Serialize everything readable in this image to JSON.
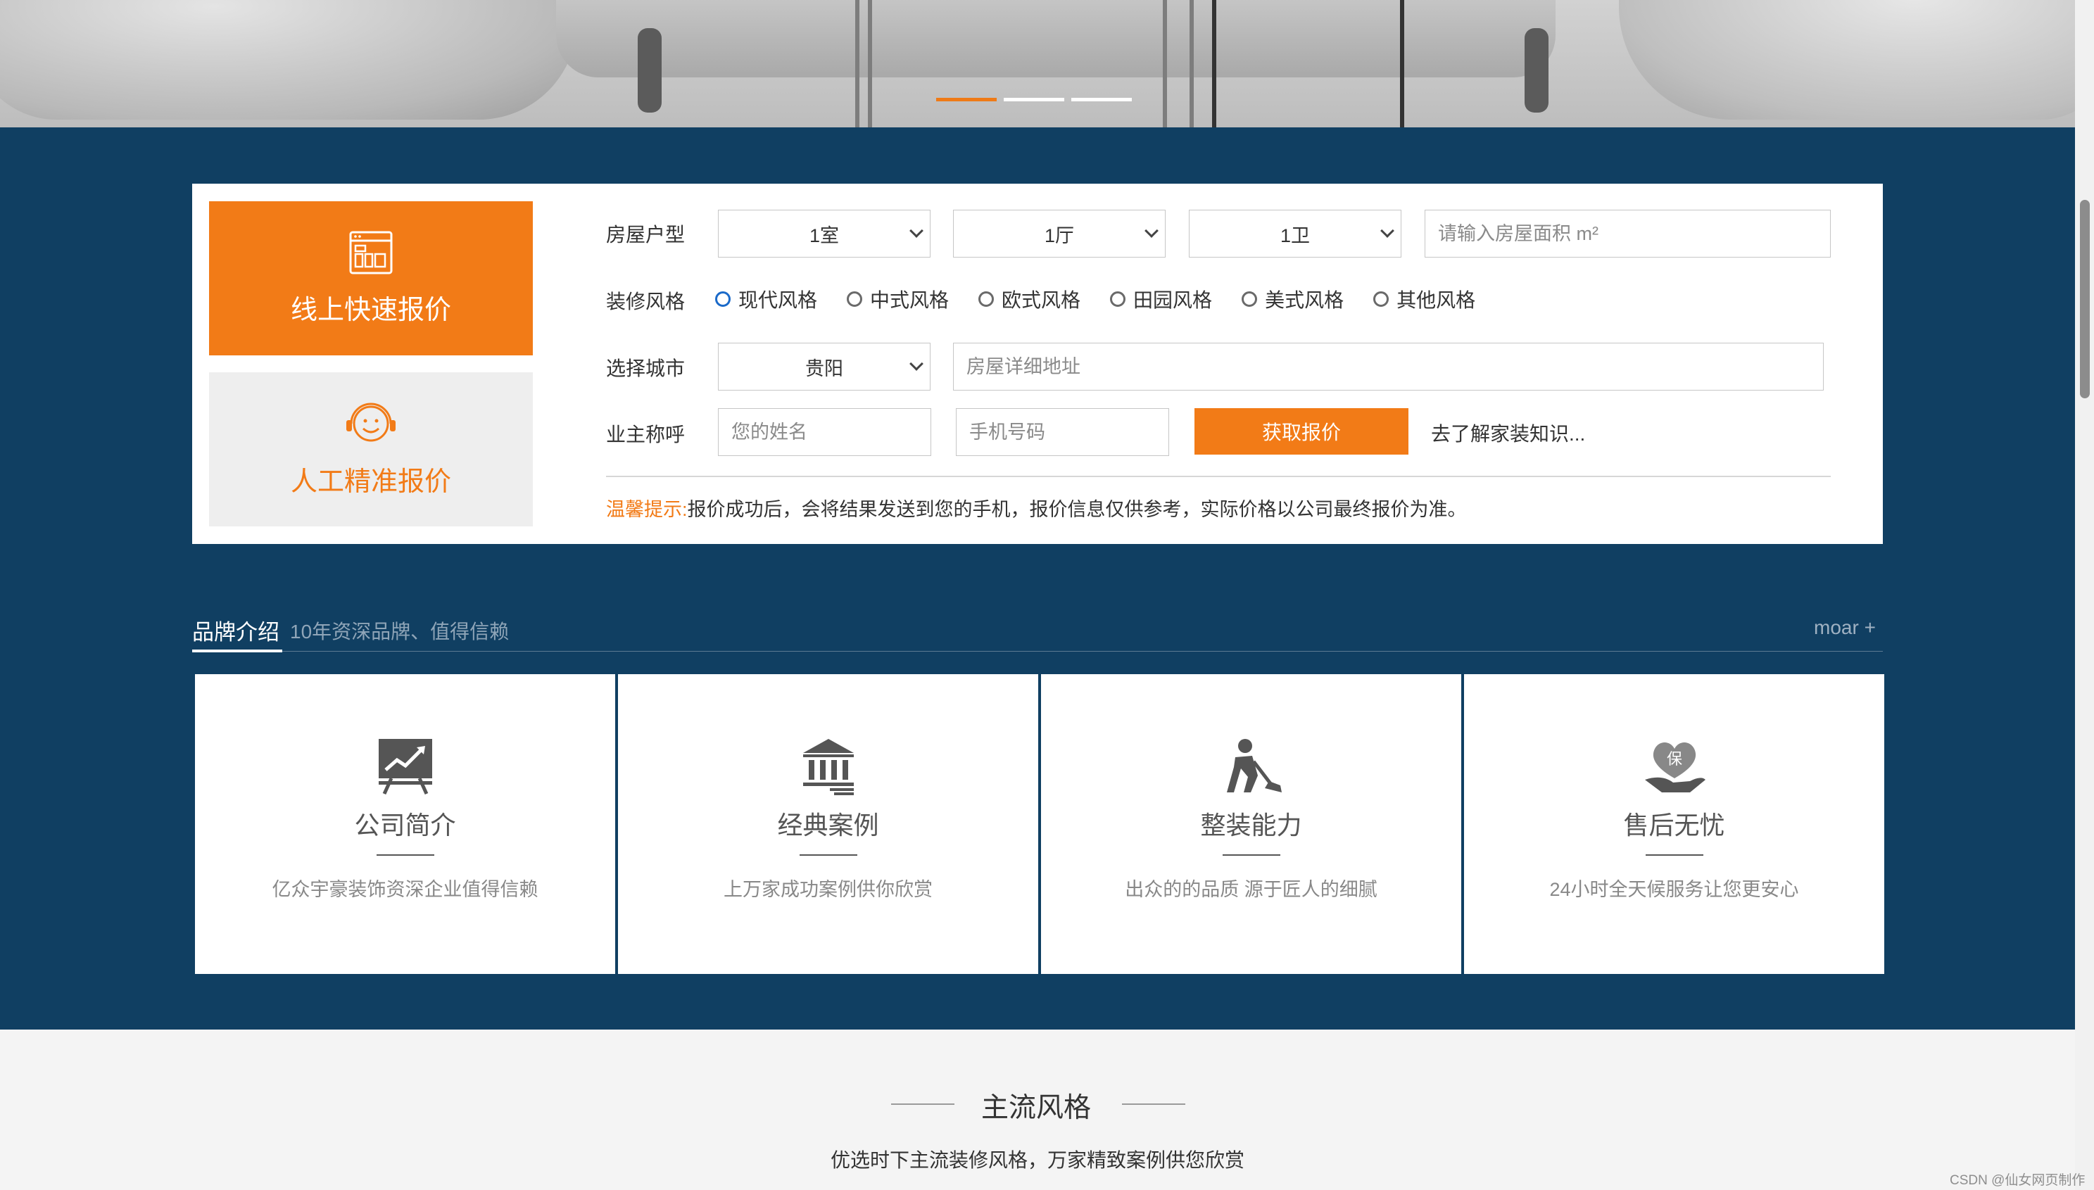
{
  "hero": {
    "active_dot": 0,
    "dots": 3
  },
  "quote": {
    "tab_online": "线上快速报价",
    "tab_manual": "人工精准报价",
    "house_type_label": "房屋户型",
    "room": "1室",
    "hall": "1厅",
    "bath": "1卫",
    "area_placeholder": "请输入房屋面积 m²",
    "style_label": "装修风格",
    "styles": [
      "现代风格",
      "中式风格",
      "欧式风格",
      "田园风格",
      "美式风格",
      "其他风格"
    ],
    "selected_style": "现代风格",
    "city_label": "选择城市",
    "city": "贵阳",
    "address_placeholder": "房屋详细地址",
    "owner_label": "业主称呼",
    "name_placeholder": "您的姓名",
    "phone_placeholder": "手机号码",
    "submit": "获取报价",
    "learn_link": "去了解家装知识...",
    "tip_head": "温馨提示:",
    "tip_body": "报价成功后，会将结果发送到您的手机，报价信息仅供参考，实际价格以公司最终报价为准。"
  },
  "brand": {
    "title": "品牌介绍",
    "subtitle": "10年资深品牌、值得信赖",
    "more": "moar +",
    "cards": [
      {
        "title": "公司简介",
        "desc": "亿众宇豪装饰资深企业值得信赖",
        "icon": "chart-board-icon"
      },
      {
        "title": "经典案例",
        "desc": "上万家成功案例供你欣赏",
        "icon": "bank-building-icon"
      },
      {
        "title": "整装能力",
        "desc": "出众的的品质 源于匠人的细腻",
        "icon": "worker-shovel-icon"
      },
      {
        "title": "售后无忧",
        "desc": "24小时全天候服务让您更安心",
        "icon": "heart-hand-icon"
      }
    ]
  },
  "styles_section": {
    "title": "主流风格",
    "subtitle": "优选时下主流装修风格，万家精致案例供您欣赏"
  },
  "watermark": "CSDN @仙女网页制作",
  "colors": {
    "orange": "#f27b17",
    "navy": "#103f62"
  }
}
